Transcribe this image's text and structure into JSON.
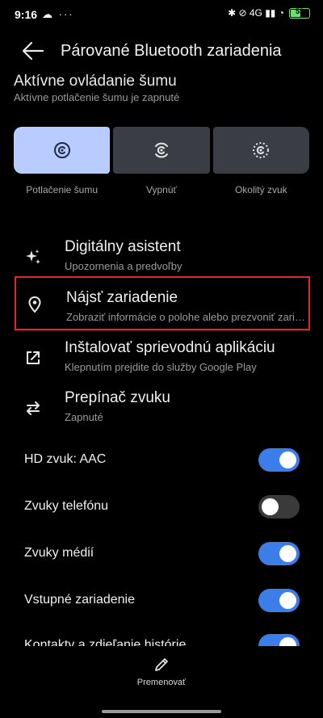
{
  "status": {
    "time": "9:16",
    "left_icons": "☁ ···",
    "right_icons": "✱ ⊘ 4G ▮▮ ◔",
    "battery_level": 0.6,
    "battery_label": "53"
  },
  "app_bar": {
    "back_icon": "arrow-back-icon",
    "title": "Párované Bluetooth zariadenia"
  },
  "anc": {
    "title": "Aktívne ovládanie šumu",
    "subtitle": "Aktívne potlačenie šumu je zapnuté",
    "modes": [
      {
        "label": "Potlačenie šumu",
        "active": true
      },
      {
        "label": "Vypnúť",
        "active": false
      },
      {
        "label": "Okolitý zvuk",
        "active": false
      }
    ]
  },
  "menu": [
    {
      "title": "Digitálny asistent",
      "subtitle": "Upozornenia a predvoľby",
      "icon": "sparkle-icon"
    },
    {
      "title": "Nájsť zariadenie",
      "subtitle": "Zobraziť informácie o polohe alebo prezvoniť zariadenie",
      "icon": "location-pin-icon"
    },
    {
      "title": "Inštalovať sprievodnú aplikáciu",
      "subtitle": "Klepnutím prejdite do služby Google Play",
      "icon": "open-external-icon"
    },
    {
      "title": "Prepínač zvuku",
      "subtitle": "Zapnuté",
      "icon": "swap-arrows-icon"
    }
  ],
  "toggles": [
    {
      "label": "HD zvuk: AAC",
      "on": true
    },
    {
      "label": "Zvuky telefónu",
      "on": false
    },
    {
      "label": "Zvuky médií",
      "on": true
    },
    {
      "label": "Vstupné zariadenie",
      "on": true
    },
    {
      "label": "Kontakty a zdieľanie histórie",
      "on": true
    }
  ],
  "bottom": {
    "rename_label": "Premenovať"
  },
  "colors": {
    "accent": "#3b7de9",
    "active_tile": "#b8ccff",
    "highlight": "#e0262a"
  }
}
